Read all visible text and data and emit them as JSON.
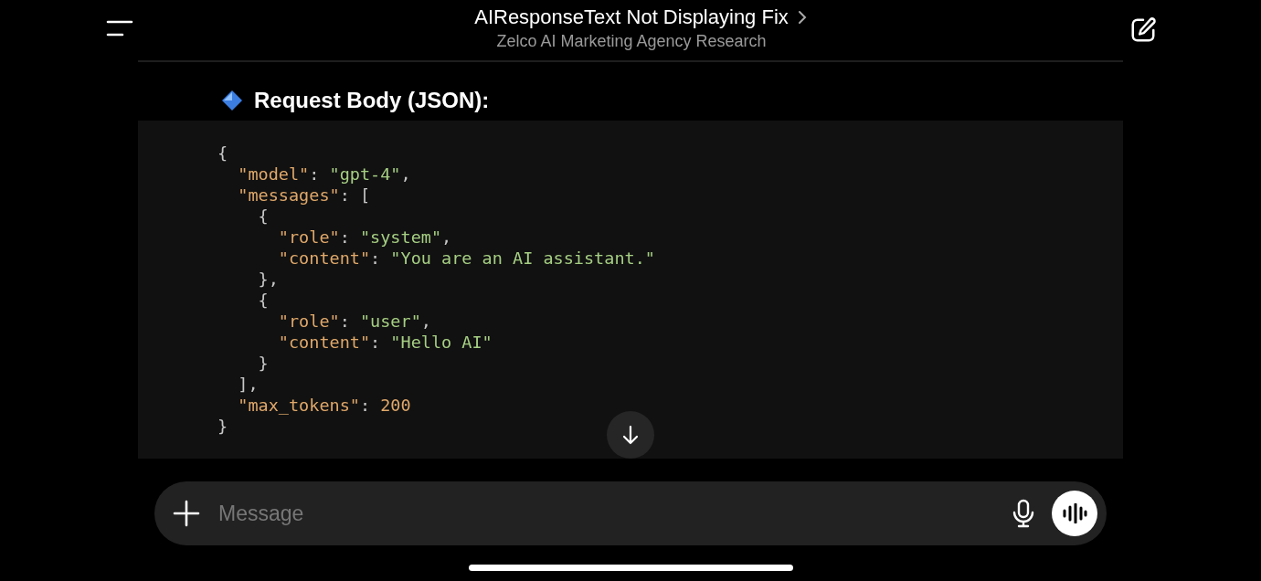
{
  "header": {
    "title": "AIResponseText Not Displaying Fix",
    "subtitle": "Zelco AI Marketing Agency Research"
  },
  "section_heading": "Request Body (JSON):",
  "code_lines": [
    [
      {
        "kind": "punct",
        "text": "{"
      }
    ],
    [
      {
        "kind": "key",
        "text": "  \"model\""
      },
      {
        "kind": "punct",
        "text": ": "
      },
      {
        "kind": "string",
        "text": "\"gpt-4\""
      },
      {
        "kind": "punct",
        "text": ","
      }
    ],
    [
      {
        "kind": "key",
        "text": "  \"messages\""
      },
      {
        "kind": "punct",
        "text": ": ["
      }
    ],
    [
      {
        "kind": "punct",
        "text": "    {"
      }
    ],
    [
      {
        "kind": "key",
        "text": "      \"role\""
      },
      {
        "kind": "punct",
        "text": ": "
      },
      {
        "kind": "string",
        "text": "\"system\""
      },
      {
        "kind": "punct",
        "text": ","
      }
    ],
    [
      {
        "kind": "key",
        "text": "      \"content\""
      },
      {
        "kind": "punct",
        "text": ": "
      },
      {
        "kind": "string",
        "text": "\"You are an AI assistant.\""
      }
    ],
    [
      {
        "kind": "punct",
        "text": "    },"
      }
    ],
    [
      {
        "kind": "punct",
        "text": "    {"
      }
    ],
    [
      {
        "kind": "key",
        "text": "      \"role\""
      },
      {
        "kind": "punct",
        "text": ": "
      },
      {
        "kind": "string",
        "text": "\"user\""
      },
      {
        "kind": "punct",
        "text": ","
      }
    ],
    [
      {
        "kind": "key",
        "text": "      \"content\""
      },
      {
        "kind": "punct",
        "text": ": "
      },
      {
        "kind": "string",
        "text": "\"Hello AI\""
      }
    ],
    [
      {
        "kind": "punct",
        "text": "    }"
      }
    ],
    [
      {
        "kind": "punct",
        "text": "  ],"
      }
    ],
    [
      {
        "kind": "key",
        "text": "  \"max_tokens\""
      },
      {
        "kind": "punct",
        "text": ": "
      },
      {
        "kind": "number",
        "text": "200"
      }
    ],
    [
      {
        "kind": "punct",
        "text": "}"
      }
    ]
  ],
  "composer": {
    "placeholder": "Message"
  }
}
